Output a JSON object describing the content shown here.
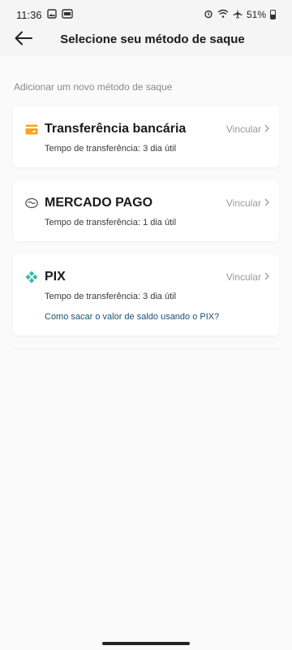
{
  "status_bar": {
    "time": "11:36",
    "battery": "51%"
  },
  "header": {
    "title": "Selecione seu método de saque"
  },
  "section_label": "Adicionar um novo método de saque",
  "methods": [
    {
      "name": "Transferência bancária",
      "action": "Vincular",
      "transfer_time": "Tempo de transferência: 3 dia útil",
      "icon": "bank-card-icon",
      "icon_color": "#f5a623"
    },
    {
      "name": "MERCADO PAGO",
      "action": "Vincular",
      "transfer_time": "Tempo de transferência: 1 dia útil",
      "icon": "mercado-pago-icon",
      "icon_color": "#555555"
    },
    {
      "name": "PIX",
      "action": "Vincular",
      "transfer_time": "Tempo de transferência: 3 dia útil",
      "help_link": "Como sacar o valor de saldo usando o PIX?",
      "icon": "pix-icon",
      "icon_color": "#32bcad"
    }
  ]
}
